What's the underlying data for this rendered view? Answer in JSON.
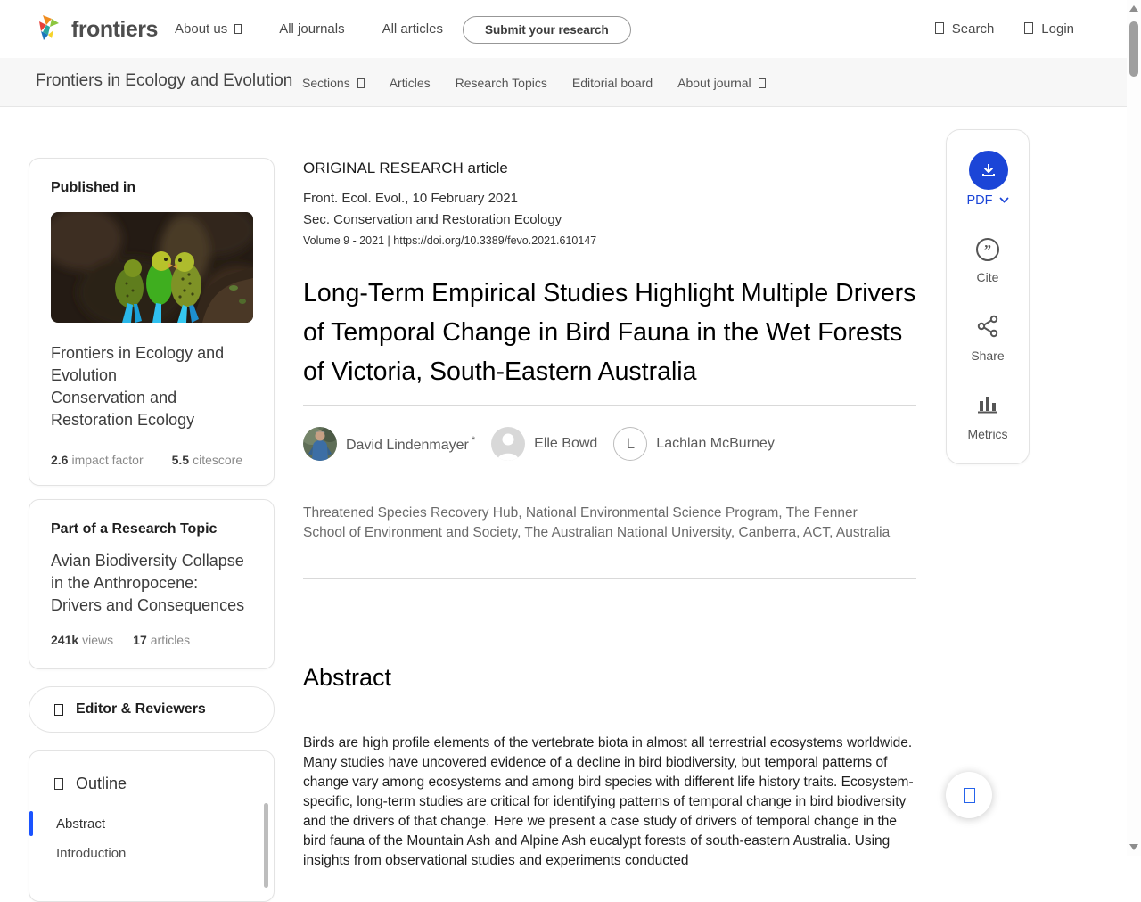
{
  "topnav": {
    "brand": "frontiers",
    "items": [
      {
        "label": "About us",
        "has_caret": true
      },
      {
        "label": "All journals",
        "has_caret": false
      },
      {
        "label": "All articles",
        "has_caret": false
      }
    ],
    "submit_label": "Submit your research",
    "search_label": "Search",
    "login_label": "Login"
  },
  "journalnav": {
    "title": "Frontiers in Ecology and Evolution",
    "items": [
      {
        "label": "Sections",
        "has_caret": true
      },
      {
        "label": "Articles",
        "has_caret": false
      },
      {
        "label": "Research Topics",
        "has_caret": false
      },
      {
        "label": "Editorial board",
        "has_caret": false
      },
      {
        "label": "About journal",
        "has_caret": true
      }
    ]
  },
  "sidebar": {
    "published_in": {
      "heading": "Published in",
      "journal": "Frontiers in Ecology and Evolution",
      "section": "Conservation and Restoration Ecology",
      "stats": [
        {
          "value": "2.6",
          "label": "impact factor"
        },
        {
          "value": "5.5",
          "label": "citescore"
        }
      ]
    },
    "research_topic": {
      "heading": "Part of a Research Topic",
      "title": "Avian Biodiversity Collapse in the Anthropocene: Drivers and Consequences",
      "stats": [
        {
          "value": "241k",
          "label": "views"
        },
        {
          "value": "17",
          "label": "articles"
        }
      ]
    },
    "editor_reviewers_label": "Editor & Reviewers",
    "outline": {
      "title": "Outline",
      "items": [
        "Abstract",
        "Introduction"
      ],
      "active_item": "Abstract"
    }
  },
  "article": {
    "type_label": "ORIGINAL RESEARCH article",
    "citation": "Front. Ecol. Evol., 10 February 2021",
    "section": "Sec. Conservation and Restoration Ecology",
    "volume": "Volume 9 - 2021",
    "divider": "|",
    "doi": "https://doi.org/10.3389/fevo.2021.610147",
    "title": "Long-Term Empirical Studies Highlight Multiple Drivers of Temporal Change in Bird Fauna in the Wet Forests of Victoria, South-Eastern Australia",
    "authors": [
      {
        "name": "David Lindenmayer",
        "mark": "*"
      },
      {
        "name": "Elle Bowd",
        "mark": ""
      },
      {
        "name": "Lachlan McBurney",
        "mark": "",
        "initial": "L"
      }
    ],
    "affiliation": "Threatened Species Recovery Hub, National Environmental Science Program, The Fenner School of Environment and Society, The Australian National University, Canberra, ACT, Australia",
    "abstract_heading": "Abstract",
    "abstract_text": "Birds are high profile elements of the vertebrate biota in almost all terrestrial ecosystems worldwide. Many studies have uncovered evidence of a decline in bird biodiversity, but temporal patterns of change vary among ecosystems and among bird species with different life history traits. Ecosystem-specific, long-term studies are critical for identifying patterns of temporal change in bird biodiversity and the drivers of that change. Here we present a case study of drivers of temporal change in the bird fauna of the Mountain Ash and Alpine Ash eucalypt forests of south-eastern Australia. Using insights from observational studies and experiments conducted"
  },
  "actions": {
    "pdf_label": "PDF",
    "cite_label": "Cite",
    "share_label": "Share",
    "metrics_label": "Metrics"
  },
  "colors": {
    "accent_blue": "#1b45d7",
    "outline_active_blue": "#1a53ff",
    "floating_icon_blue": "#2563eb"
  }
}
